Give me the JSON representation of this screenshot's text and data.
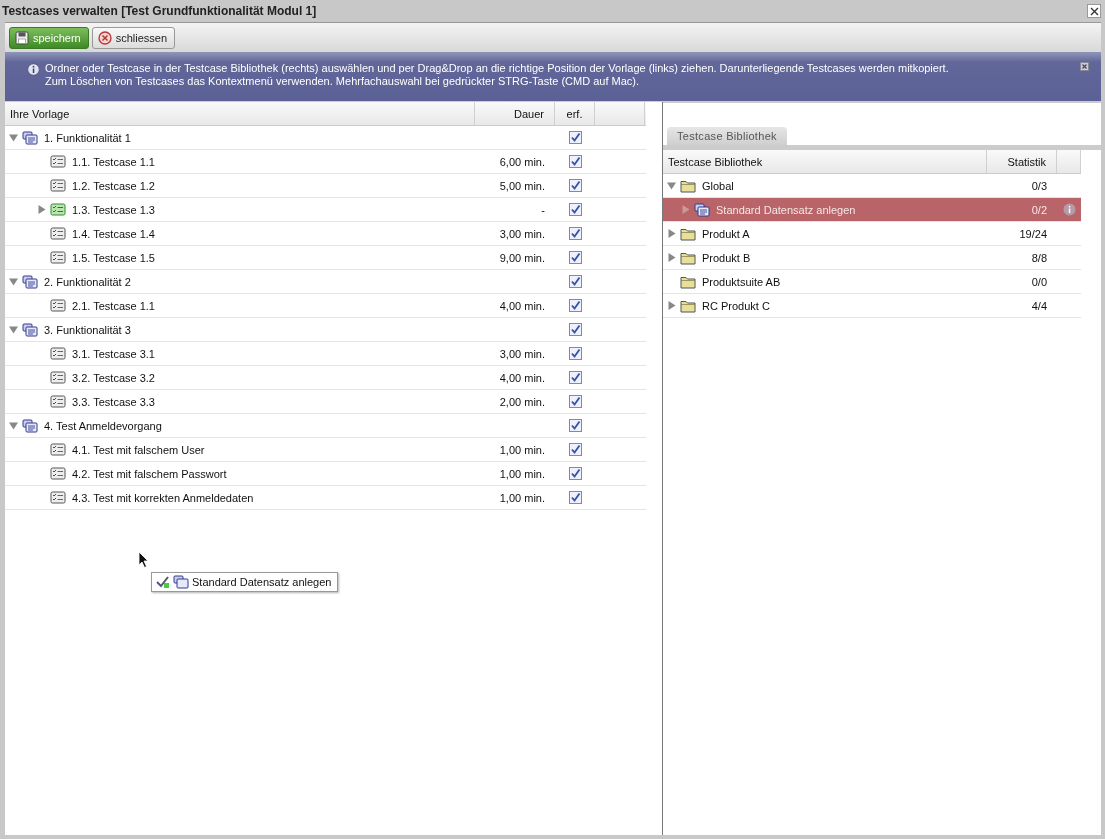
{
  "window": {
    "title": "Testcases verwalten [Test Grundfunktionalität Modul 1]"
  },
  "toolbar": [
    {
      "kind": "save",
      "label": "speichern"
    },
    {
      "kind": "close",
      "label": "schliessen"
    }
  ],
  "info": {
    "lines": [
      "Ordner oder Testcase in der Testcase Bibliothek (rechts) auswählen und per Drag&Drop an die richtige Position der Vorlage (links) ziehen. Darunterliegende Testcases werden mitkopiert.",
      "Zum Löschen von Testcases das Kontextmenü verwenden. Mehrfachauswahl bei gedrückter STRG-Taste (CMD auf Mac)."
    ]
  },
  "vorlage": {
    "columns": [
      "Ihre Vorlage",
      "Dauer",
      "erf."
    ],
    "rows": [
      {
        "kind": "set",
        "label": "1. Funktionalität 1",
        "expanded": true,
        "checked": true,
        "children": [
          {
            "kind": "testcase",
            "label": "1.1. Testcase 1.1",
            "duration": "6,00 min.",
            "checked": true
          },
          {
            "kind": "testcase",
            "label": "1.2. Testcase 1.2",
            "duration": "5,00 min.",
            "checked": true
          },
          {
            "kind": "linked",
            "label": "1.3. Testcase 1.3",
            "duration": "-",
            "checked": true,
            "expanded": false
          },
          {
            "kind": "testcase",
            "label": "1.4. Testcase 1.4",
            "duration": "3,00 min.",
            "checked": true
          },
          {
            "kind": "testcase",
            "label": "1.5. Testcase 1.5",
            "duration": "9,00 min.",
            "checked": true
          }
        ]
      },
      {
        "kind": "set",
        "label": "2. Funktionalität 2",
        "expanded": true,
        "checked": true,
        "children": [
          {
            "kind": "testcase",
            "label": "2.1. Testcase 1.1",
            "duration": "4,00 min.",
            "checked": true
          }
        ]
      },
      {
        "kind": "set",
        "label": "3. Funktionalität 3",
        "expanded": true,
        "checked": true,
        "children": [
          {
            "kind": "testcase",
            "label": "3.1. Testcase 3.1",
            "duration": "3,00 min.",
            "checked": true
          },
          {
            "kind": "testcase",
            "label": "3.2. Testcase 3.2",
            "duration": "4,00 min.",
            "checked": true
          },
          {
            "kind": "testcase",
            "label": "3.3. Testcase 3.3",
            "duration": "2,00 min.",
            "checked": true
          }
        ]
      },
      {
        "kind": "set",
        "label": "4. Test Anmeldevorgang",
        "expanded": true,
        "checked": true,
        "children": [
          {
            "kind": "testcase",
            "label": "4.1. Test mit falschem User",
            "duration": "1,00 min.",
            "checked": true
          },
          {
            "kind": "testcase",
            "label": "4.2. Test mit falschem Passwort",
            "duration": "1,00 min.",
            "checked": true
          },
          {
            "kind": "testcase",
            "label": "4.3. Test mit korrekten Anmeldedaten",
            "duration": "1,00 min.",
            "checked": true
          }
        ]
      }
    ]
  },
  "drag_proxy": {
    "label": "Standard Datensatz anlegen"
  },
  "library": {
    "tab": "Testcase Bibliothek",
    "columns": [
      "Testcase Bibliothek",
      "Statistik"
    ],
    "rows": [
      {
        "kind": "folder",
        "label": "Global",
        "stat": "0/3",
        "expanded": true,
        "selected": false,
        "children": [
          {
            "kind": "set",
            "label": "Standard Datensatz anlegen",
            "stat": "0/2",
            "expanded": false,
            "selected": true,
            "info": true
          }
        ]
      },
      {
        "kind": "folder",
        "label": "Produkt A",
        "stat": "19/24",
        "expanded": false,
        "selected": false
      },
      {
        "kind": "folder",
        "label": "Produkt B",
        "stat": "8/8",
        "expanded": false,
        "selected": false
      },
      {
        "kind": "folder",
        "label": "Produktsuite AB",
        "stat": "0/0",
        "selected": false
      },
      {
        "kind": "folder",
        "label": "RC Produkt C",
        "stat": "4/4",
        "expanded": false,
        "selected": false
      }
    ]
  }
}
